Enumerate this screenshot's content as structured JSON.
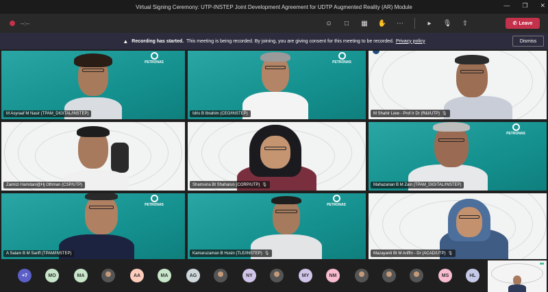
{
  "window": {
    "title": "Virtual Signing Ceremony: UTP-INSTEP Joint Development Agreement for UDTP Augmented Reality (AR) Module"
  },
  "toolbar": {
    "timer": "--:--",
    "leave_label": "Leave"
  },
  "banner": {
    "bold": "Recording has started.",
    "text": "This meeting is being recorded. By joining, you are giving consent for this meeting to be recorded.",
    "link": "Privacy policy",
    "dismiss": "Dismiss"
  },
  "logo_text": "PETRONAS",
  "participants": [
    {
      "name": "M Asyraaf M Nasir (TPAM_DIGITAL/INSTEP)"
    },
    {
      "name": "Idris B Ibrahim (CEO/INSTEP)"
    },
    {
      "name": "M Shahir Liew - Prof Ir Dr (R&I/UTP)"
    },
    {
      "name": "Zaimizi Hamdani@Hj Othman (CSP/UTP)"
    },
    {
      "name": "Shamsina Bt Shaharun (CORP/UTP)"
    },
    {
      "name": "Mahazanan B M Zain (TPAM_DIGITAL/INSTEP)"
    },
    {
      "name": "A Salam B M Sariff (TPAM/INSTEP)"
    },
    {
      "name": "Kamaruzaman B Husin (TLE/INSTEP)"
    },
    {
      "name": "Mazayanti Bt M Ariffin - Dr (ACAD/UTP)"
    }
  ],
  "overflow": {
    "more": "+7",
    "initials": [
      "MO",
      "MA",
      "AA",
      "MA",
      "AG",
      "NY",
      "MY",
      "NM",
      "MS",
      "HL"
    ]
  },
  "colors": {
    "teal": "#14918f",
    "leave": "#c4314b",
    "banner": "#2d2c3e"
  }
}
